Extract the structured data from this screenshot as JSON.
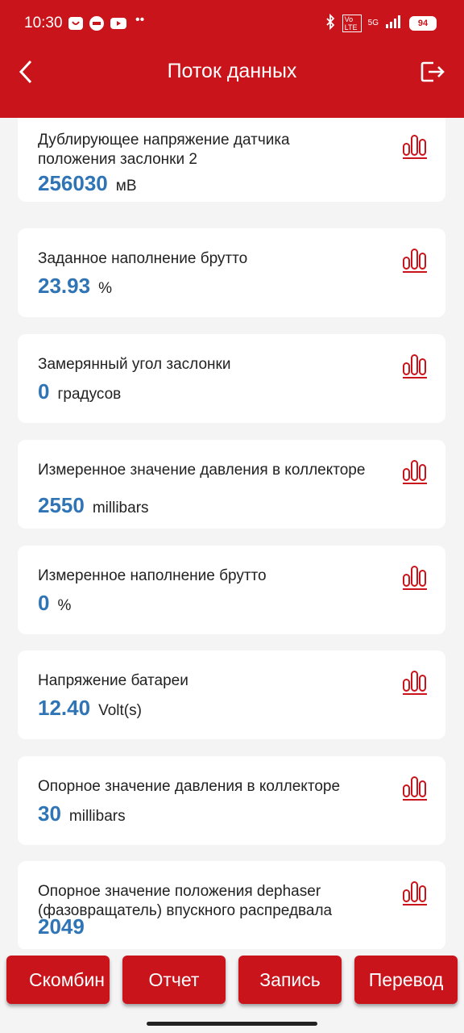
{
  "status_bar": {
    "time": "10:30",
    "network": "5G",
    "volte": "Vo LTE",
    "battery": "94"
  },
  "header": {
    "title": "Поток данных"
  },
  "items": [
    {
      "label": "Дублирующее  напряжение датчика положения заслонки 2",
      "value": "256030",
      "unit": "мВ"
    },
    {
      "label": "Заданное наполнение брутто",
      "value": "23.93",
      "unit": "%"
    },
    {
      "label": "Замерянный угол заслонки",
      "value": "0",
      "unit": "градусов"
    },
    {
      "label": "Измеренное значение давления в коллекторе",
      "value": "2550",
      "unit": "millibars"
    },
    {
      "label": "Измеренное наполнение брутто",
      "value": "0",
      "unit": "%"
    },
    {
      "label": "Напряжение батареи",
      "value": "12.40",
      "unit": "Volt(s)"
    },
    {
      "label": "Опорное значение давления в коллекторе",
      "value": "30",
      "unit": "millibars"
    },
    {
      "label": "Опорное значение положения dephaser (фазовращатель) впускного распредвала",
      "value": "2049",
      "unit": ""
    }
  ],
  "buttons": {
    "combine": "Скомбин",
    "report": "Отчет",
    "record": "Запись",
    "translate": "Перевод"
  },
  "colors": {
    "accent": "#c8141a",
    "value": "#2f74b5"
  }
}
